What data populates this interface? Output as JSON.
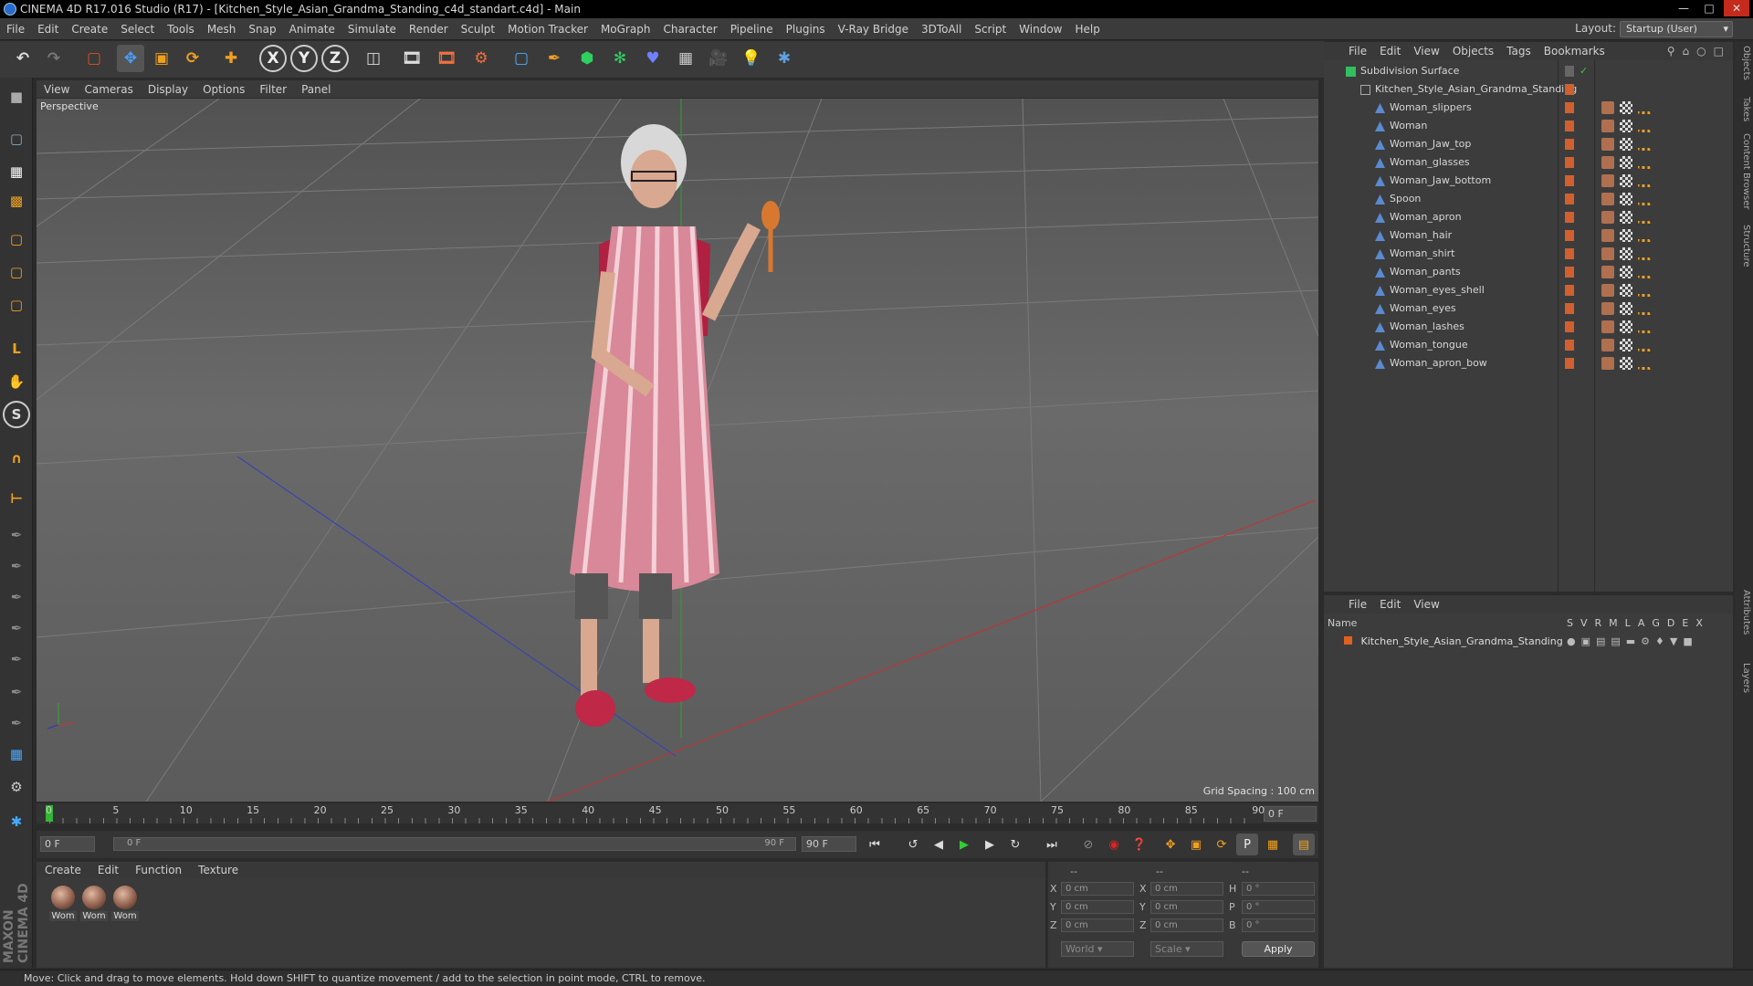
{
  "window": {
    "title": "CINEMA 4D R17.016 Studio (R17) - [Kitchen_Style_Asian_Grandma_Standing_c4d_standart.c4d] - Main"
  },
  "menu": [
    "File",
    "Edit",
    "Create",
    "Select",
    "Tools",
    "Mesh",
    "Snap",
    "Animate",
    "Simulate",
    "Render",
    "Sculpt",
    "Motion Tracker",
    "MoGraph",
    "Character",
    "Pipeline",
    "Plugins",
    "V-Ray Bridge",
    "3DToAll",
    "Script",
    "Window",
    "Help"
  ],
  "layout": {
    "label": "Layout:",
    "value": "Startup (User)"
  },
  "viewport": {
    "menu": [
      "View",
      "Cameras",
      "Display",
      "Options",
      "Filter",
      "Panel"
    ],
    "label": "Perspective",
    "grid_spacing": "Grid Spacing : 100 cm"
  },
  "timeline": {
    "ticks": [
      "0",
      "5",
      "10",
      "15",
      "20",
      "25",
      "30",
      "35",
      "40",
      "45",
      "50",
      "55",
      "60",
      "65",
      "70",
      "75",
      "80",
      "85",
      "90"
    ],
    "frame_right": "0 F",
    "start": "0 F",
    "range_start": "0 F",
    "range_end": "90 F",
    "end": "90 F"
  },
  "objects": {
    "menu": [
      "File",
      "Edit",
      "View",
      "Objects",
      "Tags",
      "Bookmarks"
    ],
    "items": [
      {
        "name": "Subdivision Surface",
        "level": 0
      },
      {
        "name": "Kitchen_Style_Asian_Grandma_Standing",
        "level": 1
      },
      {
        "name": "Woman_slippers",
        "level": 2
      },
      {
        "name": "Woman",
        "level": 2
      },
      {
        "name": "Woman_Jaw_top",
        "level": 2
      },
      {
        "name": "Woman_glasses",
        "level": 2
      },
      {
        "name": "Woman_Jaw_bottom",
        "level": 2
      },
      {
        "name": "Spoon",
        "level": 2
      },
      {
        "name": "Woman_apron",
        "level": 2
      },
      {
        "name": "Woman_hair",
        "level": 2
      },
      {
        "name": "Woman_shirt",
        "level": 2
      },
      {
        "name": "Woman_pants",
        "level": 2
      },
      {
        "name": "Woman_eyes_shell",
        "level": 2
      },
      {
        "name": "Woman_eyes",
        "level": 2
      },
      {
        "name": "Woman_lashes",
        "level": 2
      },
      {
        "name": "Woman_tongue",
        "level": 2
      },
      {
        "name": "Woman_apron_bow",
        "level": 2
      }
    ]
  },
  "layers": {
    "menu": [
      "File",
      "Edit",
      "View"
    ],
    "header_name": "Name",
    "cols": [
      "S",
      "V",
      "R",
      "M",
      "L",
      "A",
      "G",
      "D",
      "E",
      "X"
    ],
    "row": "Kitchen_Style_Asian_Grandma_Standing"
  },
  "materials": {
    "menu": [
      "Create",
      "Edit",
      "Function",
      "Texture"
    ],
    "items": [
      "Wom",
      "Wom",
      "Wom"
    ]
  },
  "coords": {
    "header": [
      "--",
      "--",
      "--"
    ],
    "rows": [
      {
        "a": "X",
        "av": "0 cm",
        "b": "X",
        "bv": "0 cm",
        "c": "H",
        "cv": "0 °"
      },
      {
        "a": "Y",
        "av": "0 cm",
        "b": "Y",
        "bv": "0 cm",
        "c": "P",
        "cv": "0 °"
      },
      {
        "a": "Z",
        "av": "0 cm",
        "b": "Z",
        "bv": "0 cm",
        "c": "B",
        "cv": "0 °"
      }
    ],
    "mode": "World",
    "scale": "Scale",
    "apply": "Apply"
  },
  "side_tabs": [
    "Objects",
    "Takes",
    "Content Browser",
    "Structure",
    "Attributes",
    "Layers"
  ],
  "status": "Move: Click and drag to move elements. Hold down SHIFT to quantize movement / add to the selection in point mode, CTRL to remove.",
  "brand": "MAXON CINEMA 4D"
}
